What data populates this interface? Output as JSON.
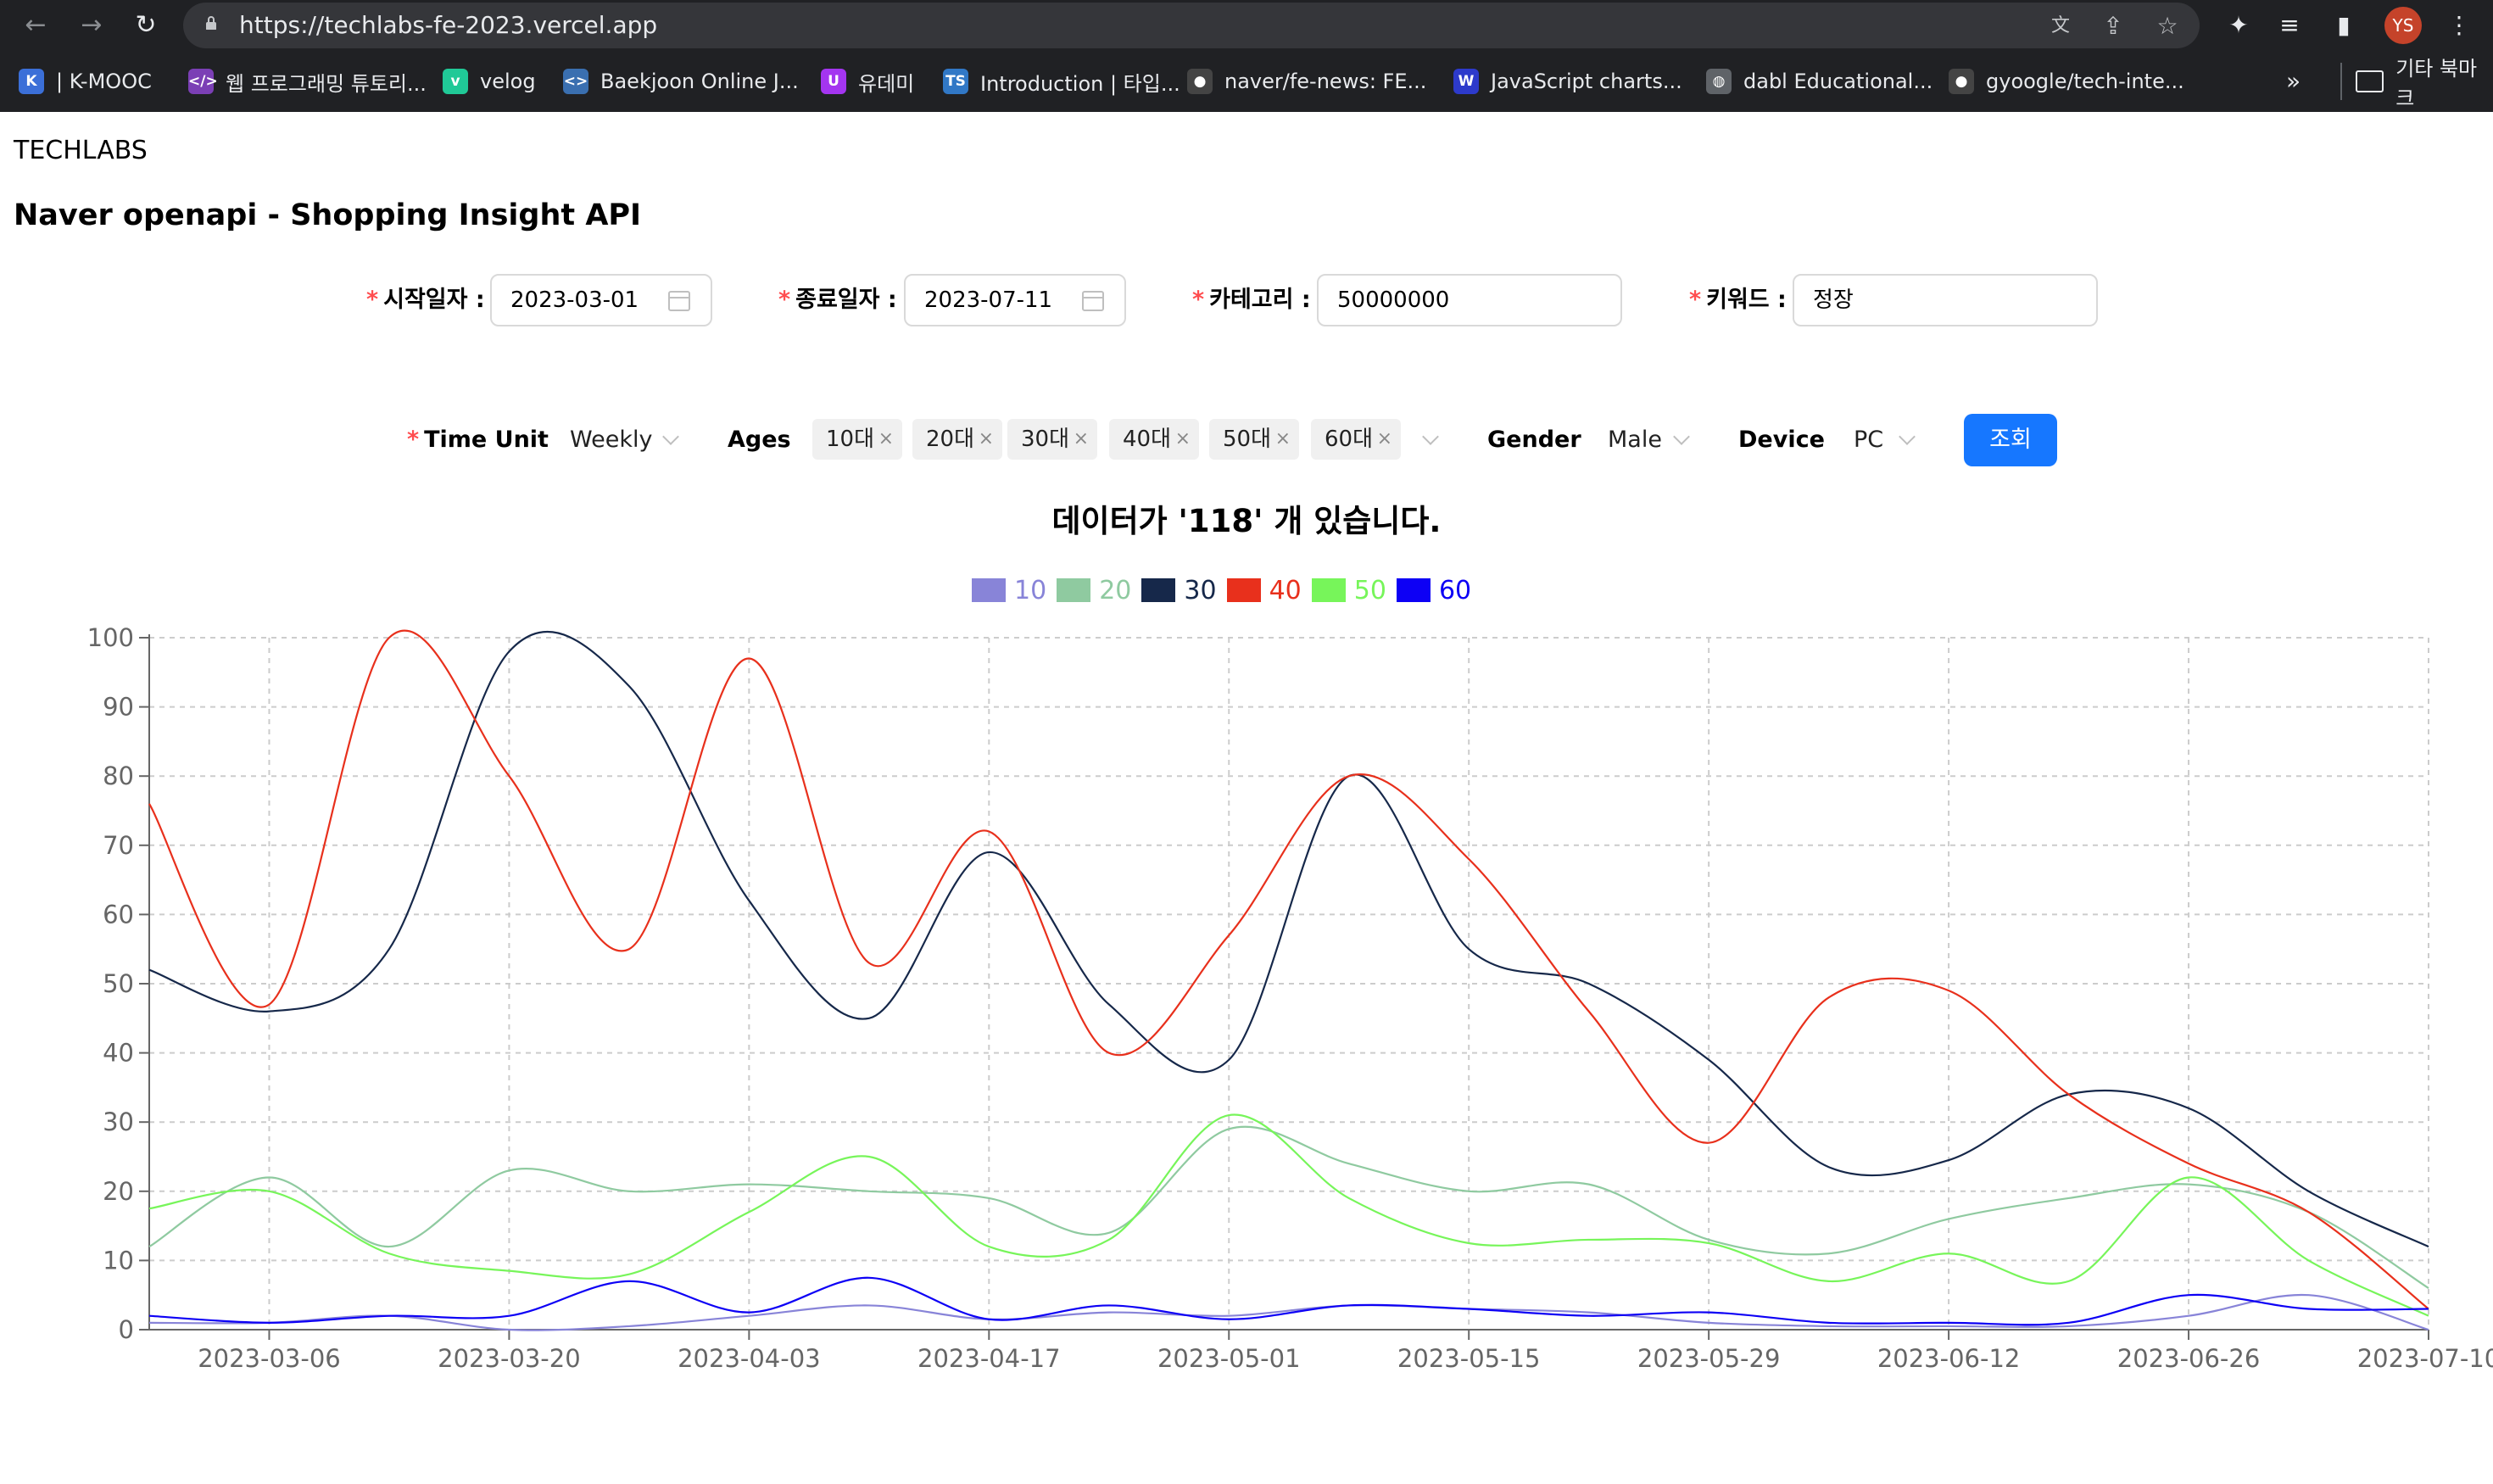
{
  "browser": {
    "url": "https://techlabs-fe-2023.vercel.app",
    "profile_initials": "YS",
    "bookmarks": [
      {
        "label": "| K-MOOC",
        "icon": "kmooc-icon",
        "color": "#3b6fd8",
        "glyph": "K"
      },
      {
        "label": "웹 프로그래밍 튜토리...",
        "icon": "code-icon",
        "color": "#7b3fb5",
        "glyph": "</>"
      },
      {
        "label": "velog",
        "icon": "velog-icon",
        "color": "#20c997",
        "glyph": "v"
      },
      {
        "label": "Baekjoon Online J...",
        "icon": "baekjoon-icon",
        "color": "#3a6fb0",
        "glyph": "<>"
      },
      {
        "label": "유데미",
        "icon": "udemy-icon",
        "color": "#a435f0",
        "glyph": "U"
      },
      {
        "label": "Introduction | 타입...",
        "icon": "typescript-icon",
        "color": "#3178c6",
        "glyph": "TS"
      },
      {
        "label": "naver/fe-news: FE...",
        "icon": "github-icon",
        "color": "#444444",
        "glyph": "●"
      },
      {
        "label": "JavaScript charts...",
        "icon": "chart-site-icon",
        "color": "#2d3acb",
        "glyph": "W"
      },
      {
        "label": "dabl Educational...",
        "icon": "globe-icon",
        "color": "#5f6368",
        "glyph": "◍"
      },
      {
        "label": "gyoogle/tech-inte...",
        "icon": "github-icon",
        "color": "#444444",
        "glyph": "●"
      }
    ],
    "more_bookmarks": "»",
    "other_bookmarks": "기타 북마크"
  },
  "page": {
    "brand": "TECHLABS",
    "title": "Naver openapi - Shopping Insight API"
  },
  "form": {
    "required_mark": "*",
    "start_label": "시작일자 :",
    "start_value": "2023-03-01",
    "end_label": "종료일자 :",
    "end_value": "2023-07-11",
    "category_label": "카테고리 :",
    "category_value": "50000000",
    "keyword_label": "키워드 :",
    "keyword_value": "정장",
    "time_unit_label": "Time Unit",
    "time_unit_value": "Weekly",
    "ages_label": "Ages",
    "ages": [
      "10대",
      "20대",
      "30대",
      "40대",
      "50대",
      "60대"
    ],
    "gender_label": "Gender",
    "gender_value": "Male",
    "device_label": "Device",
    "device_value": "PC",
    "submit_label": "조회"
  },
  "result": {
    "summary": "데이터가 '118' 개 있습니다."
  },
  "chart_data": {
    "type": "line",
    "x": [
      "2023-02-27",
      "2023-03-06",
      "2023-03-13",
      "2023-03-20",
      "2023-03-27",
      "2023-04-03",
      "2023-04-10",
      "2023-04-17",
      "2023-04-24",
      "2023-05-01",
      "2023-05-08",
      "2023-05-15",
      "2023-05-22",
      "2023-05-29",
      "2023-06-05",
      "2023-06-12",
      "2023-06-19",
      "2023-06-26",
      "2023-07-03",
      "2023-07-10"
    ],
    "xticks": [
      "2023-03-06",
      "2023-03-20",
      "2023-04-03",
      "2023-04-17",
      "2023-05-01",
      "2023-05-15",
      "2023-05-29",
      "2023-06-12",
      "2023-06-26",
      "2023-07-10"
    ],
    "yticks": [
      0,
      10,
      20,
      30,
      40,
      50,
      60,
      70,
      80,
      90,
      100
    ],
    "ylim": [
      0,
      100
    ],
    "grid": true,
    "legend": "top-center",
    "series": [
      {
        "name": "10",
        "color": "#8884d8",
        "values": [
          1,
          1,
          2,
          0,
          0.5,
          2,
          3.5,
          1.5,
          2.5,
          2,
          3.5,
          3,
          2.5,
          1,
          0.5,
          0.5,
          0.5,
          2,
          5,
          0
        ]
      },
      {
        "name": "20",
        "color": "#8fcaa0",
        "values": [
          12,
          22,
          12,
          23,
          20,
          21,
          20,
          19,
          14,
          29,
          24,
          20,
          21,
          13,
          11,
          16,
          19,
          21,
          17,
          6
        ]
      },
      {
        "name": "30",
        "color": "#16284a",
        "values": [
          52,
          46,
          55,
          98,
          93,
          62,
          45,
          69,
          47,
          39,
          80,
          55,
          50,
          39,
          23.5,
          24.5,
          34,
          32,
          20,
          12
        ]
      },
      {
        "name": "40",
        "color": "#e8301c",
        "values": [
          76,
          47,
          100,
          80,
          55,
          97,
          53,
          72,
          40,
          57,
          80,
          68,
          46,
          27,
          48,
          49,
          34,
          24,
          17,
          3
        ]
      },
      {
        "name": "50",
        "color": "#77f55a",
        "values": [
          17.5,
          20,
          11,
          8.5,
          8,
          17,
          25,
          12,
          13,
          31,
          19,
          12.5,
          13,
          12.5,
          7,
          11,
          7,
          22,
          10,
          2
        ]
      },
      {
        "name": "60",
        "color": "#0d00f5",
        "values": [
          2,
          1,
          2,
          2,
          7,
          2.5,
          7.5,
          1.5,
          3.5,
          1.5,
          3.5,
          3,
          2,
          2.5,
          1,
          1,
          1,
          5,
          3,
          3
        ]
      }
    ]
  }
}
